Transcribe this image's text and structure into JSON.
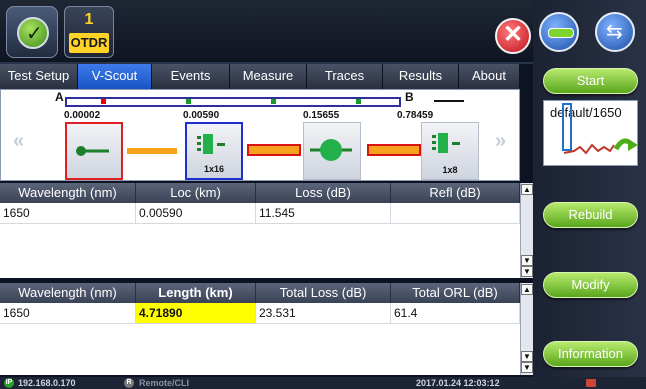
{
  "header": {
    "otdr_count": "1",
    "otdr_label": "OTDR",
    "close_symbol": "✕"
  },
  "tabs": [
    {
      "label": "Test Setup"
    },
    {
      "label": "V-Scout",
      "active": true
    },
    {
      "label": "Events"
    },
    {
      "label": "Measure"
    },
    {
      "label": "Traces"
    },
    {
      "label": "Results"
    },
    {
      "label": "About"
    }
  ],
  "scout": {
    "end_a": "A",
    "end_b": "B",
    "distances": [
      "0.00002",
      "0.00590",
      "0.15655",
      "0.78459"
    ],
    "nav_prev": "«",
    "nav_next": "»",
    "events": [
      {
        "icon": "connector-icon",
        "sub": ""
      },
      {
        "icon": "splitter-icon",
        "sub": "1x16"
      },
      {
        "icon": "splice-icon",
        "sub": ""
      },
      {
        "icon": "splitter-icon",
        "sub": "1x8"
      }
    ]
  },
  "event_table": {
    "headers": [
      "Wavelength (nm)",
      "Loc (km)",
      "Loss (dB)",
      "Refl (dB)"
    ],
    "rows": [
      [
        "1650",
        "0.00590",
        "11.545",
        ""
      ]
    ]
  },
  "summary_table": {
    "headers": [
      "Wavelength (nm)",
      "Length (km)",
      "Total Loss (dB)",
      "Total ORL (dB)"
    ],
    "rows": [
      [
        "1650",
        "4.71890",
        "23.531",
        "61.4"
      ]
    ]
  },
  "right_panel": {
    "start": "Start",
    "thumb_label": "default/1650",
    "rebuild": "Rebuild",
    "modify": "Modify",
    "information": "Information"
  },
  "status": {
    "ip": "192.168.0.170",
    "remote": "Remote/CLI",
    "datetime": "2017.01.24 12:03:12"
  },
  "colors": {
    "accent_blue": "#1954c4",
    "button_green": "#5aa61d",
    "highlight_yellow": "#ffff00",
    "link_orange": "#f7a21b"
  }
}
